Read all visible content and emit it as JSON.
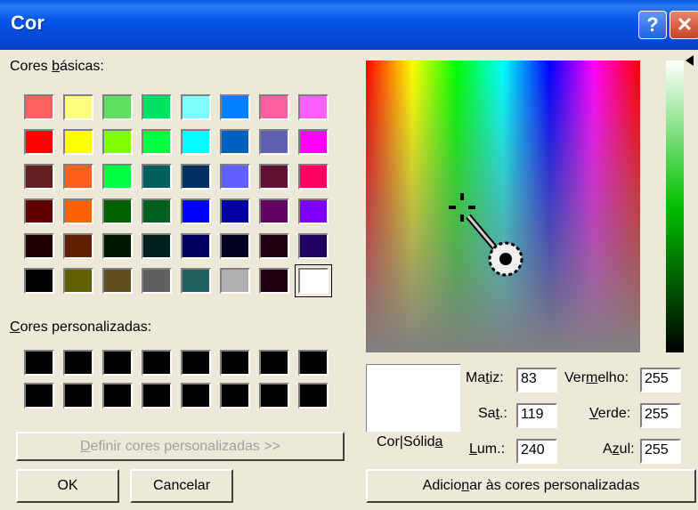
{
  "window": {
    "title": "Cor",
    "help_label": "?",
    "close_label": "✕"
  },
  "basic": {
    "label_pre": "Cores ",
    "label_mn": "b",
    "label_post": "ásicas:",
    "colors": [
      [
        "#ff6060",
        "#ffff80",
        "#60e060",
        "#00e060",
        "#80ffff",
        "#0080ff",
        "#ff60a0",
        "#ff60ff"
      ],
      [
        "#ff0000",
        "#ffff00",
        "#80ff00",
        "#00ff40",
        "#00ffff",
        "#0060c0",
        "#6060b0",
        "#ff00ff"
      ],
      [
        "#602020",
        "#ff6020",
        "#00ff40",
        "#006060",
        "#003060",
        "#6060ff",
        "#601030",
        "#ff0060"
      ],
      [
        "#600000",
        "#ff6000",
        "#006000",
        "#006020",
        "#0000ff",
        "#0000a0",
        "#600060",
        "#8000ff"
      ],
      [
        "#200000",
        "#602000",
        "#001800",
        "#002020",
        "#000060",
        "#000020",
        "#200010",
        "#200060"
      ],
      [
        "#000000",
        "#606000",
        "#605020",
        "#606060",
        "#206060",
        "#b0b0b0",
        "#200010",
        "#ffffff"
      ]
    ]
  },
  "custom": {
    "label_mn": "C",
    "label_post": "ores personalizadas:",
    "colors": [
      [
        "#000000",
        "#000000",
        "#000000",
        "#000000",
        "#000000",
        "#000000",
        "#000000",
        "#000000"
      ],
      [
        "#000000",
        "#000000",
        "#000000",
        "#000000",
        "#000000",
        "#000000",
        "#000000",
        "#000000"
      ]
    ]
  },
  "buttons": {
    "define_mn": "D",
    "define_post": "efinir cores personalizadas >>",
    "ok": "OK",
    "cancel": "Cancelar",
    "add_pre": "Adicio",
    "add_mn": "n",
    "add_post": "ar às cores personalizadas"
  },
  "preview": {
    "label_pre": "Cor|Sólid",
    "label_mn": "a",
    "color": "#ffffff"
  },
  "fields": {
    "hue": {
      "pre": "Ma",
      "mn": "t",
      "post": "iz:",
      "value": "83"
    },
    "sat": {
      "pre": "Sa",
      "mn": "t",
      "post": ".:",
      "value": "119"
    },
    "lum": {
      "pre": "",
      "mn": "L",
      "post": "um.:",
      "value": "240"
    },
    "red": {
      "pre": "Ver",
      "mn": "m",
      "post": "elho:",
      "value": "255"
    },
    "green": {
      "pre": "",
      "mn": "V",
      "post": "erde:",
      "value": "255"
    },
    "blue": {
      "pre": "A",
      "mn": "z",
      "post": "ul:",
      "value": "255"
    }
  }
}
